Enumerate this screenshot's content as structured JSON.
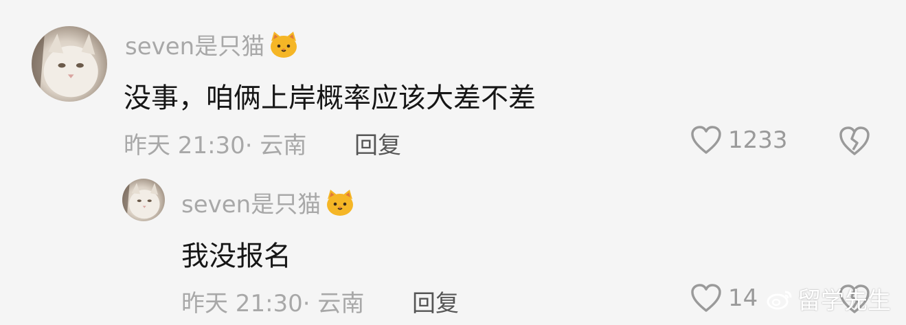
{
  "comments": [
    {
      "username": "seven是只猫",
      "text": "没事，咱俩上岸概率应该大差不差",
      "meta": "昨天 21:30· 云南",
      "reply_label": "回复",
      "likes": "1233"
    },
    {
      "username": "seven是只猫",
      "text": "我没报名",
      "meta": "昨天 21:30· 云南",
      "reply_label": "回复",
      "likes": "14"
    }
  ],
  "icons": {
    "cat_emoji": "cat-face-icon",
    "like": "heart-outline-icon",
    "dislike": "broken-heart-icon",
    "watermark": "weibo-logo-icon"
  },
  "watermark": {
    "text": "留学先生"
  },
  "colors": {
    "background": "#f5f5f5",
    "username": "#a8a8a8",
    "text": "#161616",
    "reply": "#555555",
    "icon": "#9a9a9a",
    "emoji": "#f5b626"
  }
}
